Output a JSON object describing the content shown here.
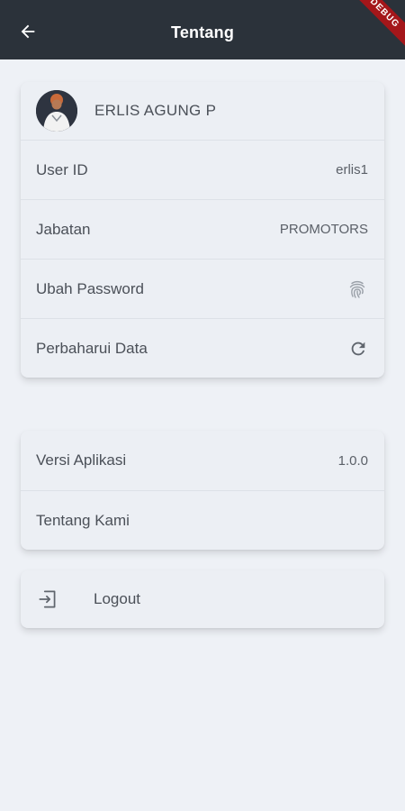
{
  "appbar": {
    "title": "Tentang",
    "back_icon": "arrow-left-icon",
    "debug_banner": "DEBUG"
  },
  "profile": {
    "name": "ERLIS AGUNG P",
    "avatar_icon": "user-avatar"
  },
  "account": {
    "rows": [
      {
        "label": "User ID",
        "value": "erlis1"
      },
      {
        "label": "Jabatan",
        "value": "PROMOTORS"
      },
      {
        "label": "Ubah Password",
        "icon": "fingerprint-icon"
      },
      {
        "label": "Perbaharui Data",
        "icon": "refresh-icon"
      }
    ]
  },
  "app_info": {
    "rows": [
      {
        "label": "Versi Aplikasi",
        "value": "1.0.0"
      },
      {
        "label": "Tentang Kami"
      }
    ]
  },
  "logout": {
    "label": "Logout",
    "icon": "logout-icon"
  },
  "colors": {
    "appbar": "#2b323a",
    "background": "#eef1f6",
    "card": "#eceff4",
    "text": "#4b5058",
    "debug_ribbon": "#a4161a"
  }
}
